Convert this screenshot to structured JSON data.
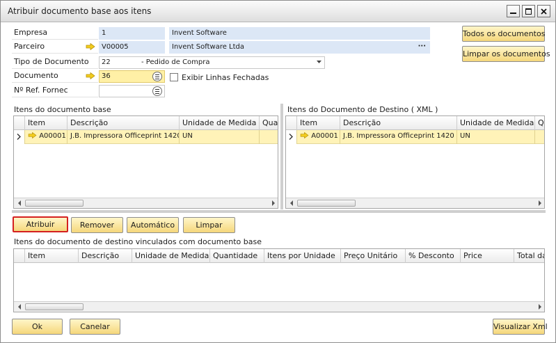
{
  "window": {
    "title": "Atribuir documento base aos itens"
  },
  "form": {
    "empresa_label": "Empresa",
    "empresa_code": "1",
    "empresa_name": "Invent Software",
    "parceiro_label": "Parceiro",
    "parceiro_code": "V00005",
    "parceiro_name": "Invent Software Ltda",
    "parceiro_more": "···",
    "tipo_label": "Tipo de Documento",
    "tipo_value": "22",
    "tipo_desc": "- Pedido de Compra",
    "documento_label": "Documento",
    "documento_value": "36",
    "exibir_label": "Exibir Linhas Fechadas",
    "ref_label": "Nº Ref. Fornec",
    "ref_value": ""
  },
  "side_buttons": {
    "todos": "Todos os documentos",
    "limpar": "Limpar os documentos"
  },
  "base_grid": {
    "title": "Itens do documento base",
    "columns": [
      "Item",
      "Descrição",
      "Unidade de Medida",
      "Qua"
    ],
    "rows": [
      {
        "item": "A00001",
        "descricao": "J.B. Impressora Officeprint 1420",
        "unidade": "UN",
        "qtd": ""
      }
    ]
  },
  "dest_grid": {
    "title": "Itens do Documento de Destino ( XML )",
    "columns": [
      "Item",
      "Descrição",
      "Unidade de Medida",
      "Qu"
    ],
    "rows": [
      {
        "item": "A00001",
        "descricao": "J.B. Impressora Officeprint 1420",
        "unidade": "UN",
        "qtd": ""
      }
    ]
  },
  "actions": {
    "atribuir": "Atribuir",
    "remover": "Remover",
    "automatico": "Automático",
    "limpar": "Limpar"
  },
  "linked_grid": {
    "title": "Itens do documento de destino vinculados com documento base",
    "columns": [
      "Item",
      "Descrição",
      "Unidade de Medida",
      "Quantidade",
      "Itens por Unidade",
      "Preço Unitário",
      "% Desconto",
      "Price",
      "Total da"
    ]
  },
  "footer": {
    "ok": "Ok",
    "cancelar": "Canelar",
    "visualizar": "Visualizar Xml"
  },
  "colors": {
    "button_top": "#fff6c9",
    "button_bottom": "#f5d77b",
    "selected_row": "#fff3b8",
    "field_blue": "#dce7f6",
    "field_yellow": "#fff0a6",
    "selected_border": "#d42020",
    "link_arrow": "#e8b800"
  }
}
